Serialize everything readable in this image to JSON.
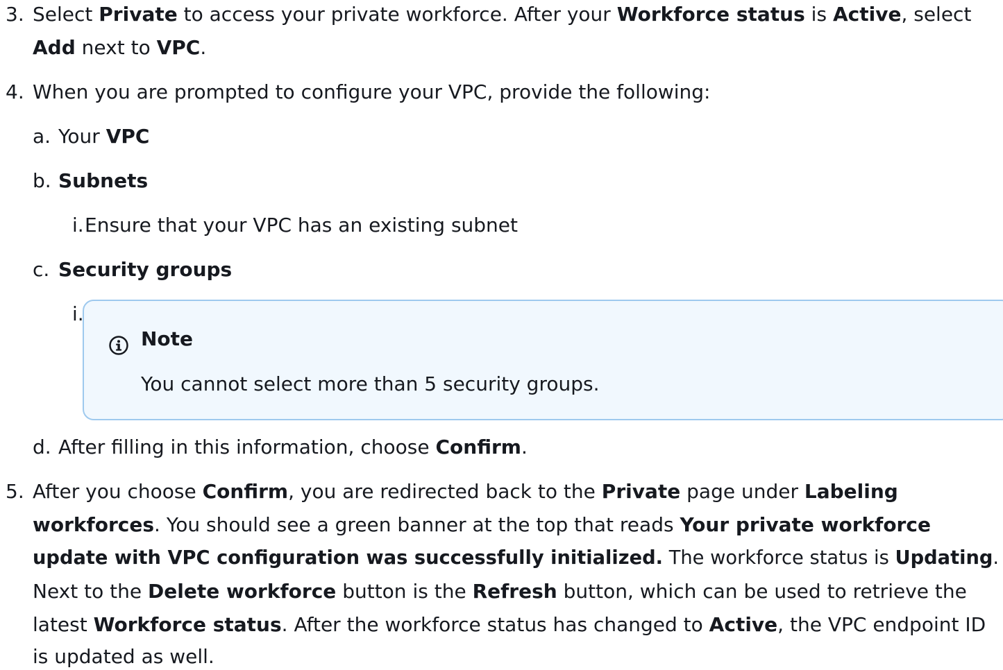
{
  "steps": {
    "s3": {
      "num": "3.",
      "line1": {
        "t1": "Select ",
        "b1": "Private",
        "t2": " to access your private workforce. After your ",
        "b2": "Workforce status",
        "t3": " is ",
        "b3": "Active",
        "t4": ", select"
      },
      "line2": {
        "b1": "Add",
        "t1": " next to ",
        "b2": "VPC",
        "t2": "."
      }
    },
    "s4": {
      "num": "4.",
      "text": "When you are prompted to configure your VPC, provide the following:",
      "a": {
        "label": "a.",
        "t1": "Your ",
        "b1": "VPC"
      },
      "b": {
        "label": "b.",
        "b1": "Subnets",
        "i": {
          "label": "i.",
          "text": "Ensure that your VPC has an existing subnet"
        }
      },
      "c": {
        "label": "c.",
        "b1": "Security groups",
        "i": {
          "label": "i."
        }
      },
      "d": {
        "label": "d.",
        "t1": "After filling in this information, choose ",
        "b1": "Confirm",
        "t2": "."
      }
    },
    "s5": {
      "num": "5.",
      "line1": {
        "t1": "After you choose ",
        "b1": "Confirm",
        "t2": ", you are redirected back to the ",
        "b2": "Private",
        "t3": " page under ",
        "b3": "Labeling"
      },
      "line2": {
        "b1": "workforces",
        "t1": ". You should see a green banner at the top that reads ",
        "b2": "Your private workforce"
      },
      "line3": {
        "b1": "update with VPC configuration was successfully initialized.",
        "t1": " The workforce status is ",
        "b2": "Updating",
        "t2": "."
      },
      "line4": {
        "t1": "Next to the ",
        "b1": "Delete workforce",
        "t2": " button is the ",
        "b2": "Refresh",
        "t3": " button, which can be used to retrieve the"
      },
      "line5": {
        "t1": "latest ",
        "b1": "Workforce status",
        "t2": ". After the workforce status has changed to ",
        "b2": "Active",
        "t3": ", the VPC endpoint ID"
      },
      "line6": {
        "t1": "is updated as well."
      }
    }
  },
  "note": {
    "icon": "info-icon",
    "title": "Note",
    "body": "You cannot select more than 5 security groups."
  },
  "colors": {
    "text": "#16191f",
    "note_bg": "#f1f8fe",
    "note_border": "#9ec9ee",
    "icon": "#16191f"
  }
}
